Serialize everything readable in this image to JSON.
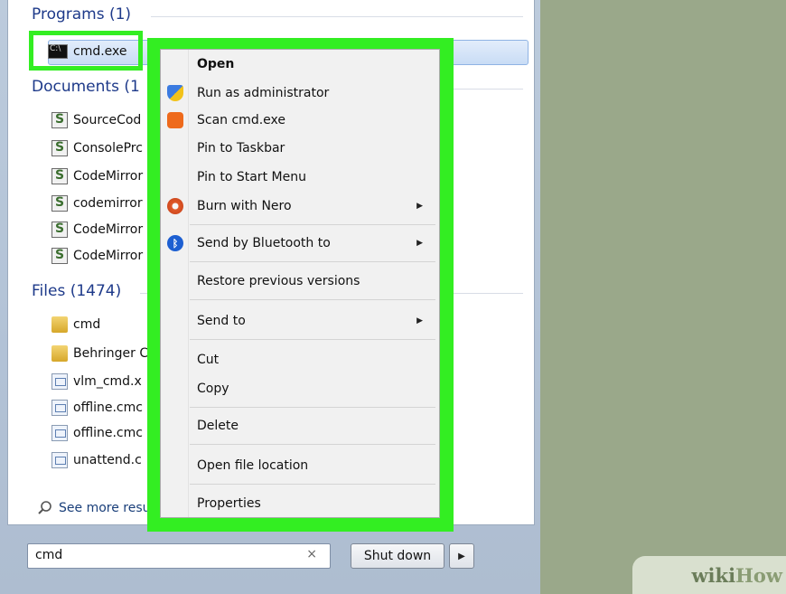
{
  "start_menu": {
    "programs_header": "Programs (1)",
    "program_item": "cmd.exe",
    "documents_header": "Documents (1",
    "documents": [
      {
        "label": "SourceCod"
      },
      {
        "label": "ConsolePrc"
      },
      {
        "label": "CodeMirror"
      },
      {
        "label": "codemirror"
      },
      {
        "label": "CodeMirror"
      },
      {
        "label": "CodeMirror"
      }
    ],
    "files_header": "Files (1474)",
    "files": [
      {
        "label": "cmd",
        "icon": "folder-icon"
      },
      {
        "label": "Behringer C",
        "icon": "folder-icon"
      },
      {
        "label": "vlm_cmd.x",
        "icon": "file-icon"
      },
      {
        "label": "offline.cmc",
        "icon": "file-icon"
      },
      {
        "label": "offline.cmc",
        "icon": "file-icon"
      },
      {
        "label": "unattend.c",
        "icon": "file-icon"
      }
    ],
    "see_more": "See more resu",
    "search_value": "cmd",
    "clear_symbol": "×",
    "shutdown_label": "Shut down",
    "shutdown_arrow": "▶"
  },
  "context_menu": {
    "items": [
      {
        "label": "Open",
        "bold": true
      },
      {
        "label": "Run as administrator",
        "icon": "uac-shield-icon"
      },
      {
        "label": "Scan cmd.exe",
        "icon": "avast-icon"
      },
      {
        "label": "Pin to Taskbar"
      },
      {
        "label": "Pin to Start Menu"
      },
      {
        "label": "Burn with Nero",
        "icon": "nero-icon",
        "arrow": "▶"
      },
      {
        "label": "Send by Bluetooth to",
        "icon": "bluetooth-icon",
        "arrow": "▶"
      },
      {
        "label": "Restore previous versions"
      },
      {
        "label": "Send to",
        "arrow": "▶"
      },
      {
        "label": "Cut"
      },
      {
        "label": "Copy"
      },
      {
        "label": "Delete"
      },
      {
        "label": "Open file location"
      },
      {
        "label": "Properties"
      }
    ]
  },
  "watermark": {
    "part1": "wiki",
    "part2": "How"
  },
  "colors": {
    "highlight_green": "#33ee22",
    "background": "#9aa88a"
  }
}
